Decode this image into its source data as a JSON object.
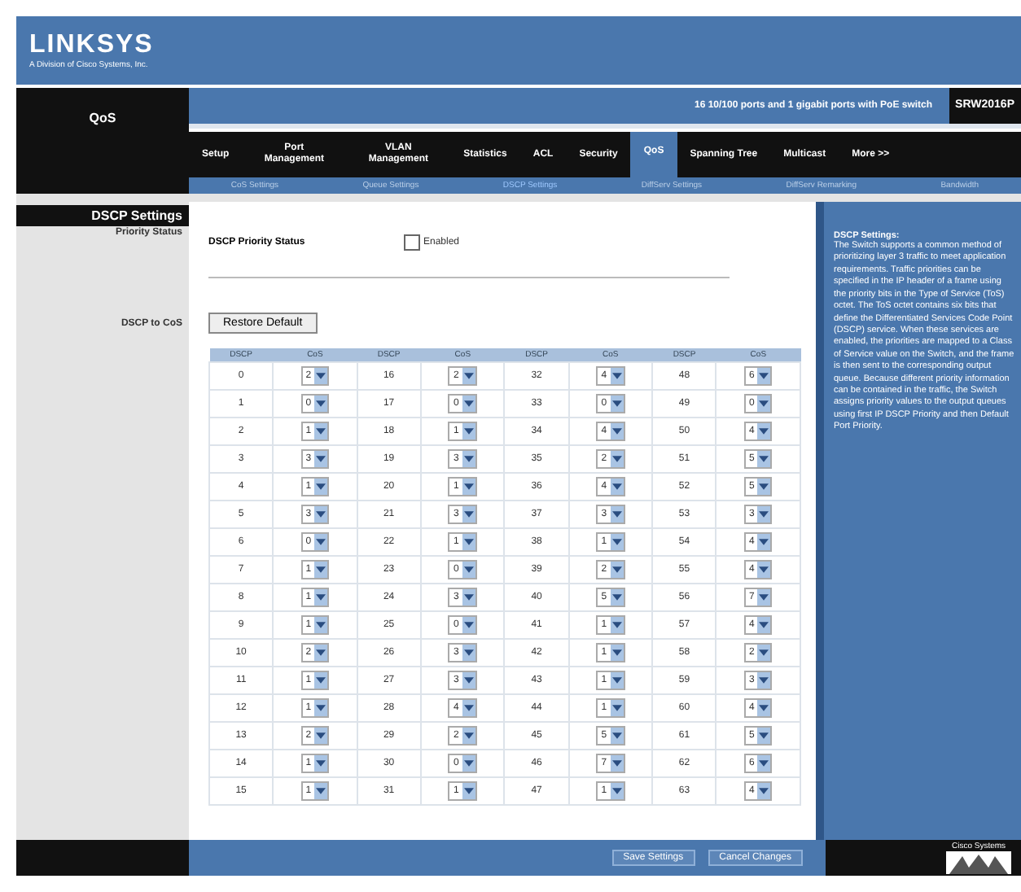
{
  "header": {
    "logo": "LINKSYS",
    "tagline": "A Division of Cisco Systems, Inc.",
    "section": "QoS",
    "description": "16 10/100 ports and 1 gigabit ports with PoE switch",
    "model": "SRW2016P"
  },
  "tabs": [
    {
      "label": "Setup",
      "selected": false
    },
    {
      "label": "Port Management",
      "selected": false
    },
    {
      "label": "VLAN Management",
      "selected": false
    },
    {
      "label": "Statistics",
      "selected": false
    },
    {
      "label": "ACL",
      "selected": false
    },
    {
      "label": "Security",
      "selected": false
    },
    {
      "label": "QoS",
      "selected": true
    },
    {
      "label": "Spanning Tree",
      "selected": false
    },
    {
      "label": "Multicast",
      "selected": false
    },
    {
      "label": "More >>",
      "selected": false
    }
  ],
  "subtabs": [
    {
      "label": "CoS Settings",
      "selected": false
    },
    {
      "label": "Queue Settings",
      "selected": false
    },
    {
      "label": "DSCP Settings",
      "selected": true
    },
    {
      "label": "DiffServ Settings",
      "selected": false
    },
    {
      "label": "DiffServ Remarking",
      "selected": false
    },
    {
      "label": "Bandwidth",
      "selected": false
    }
  ],
  "sidebar": {
    "title": "DSCP Settings",
    "items": [
      "Priority Status",
      "DSCP to CoS"
    ]
  },
  "priority_status": {
    "label": "DSCP Priority Status",
    "checkbox_label": "Enabled",
    "checked": false
  },
  "restore_button": "Restore Default",
  "table": {
    "columns": [
      "DSCP",
      "CoS",
      "DSCP",
      "CoS",
      "DSCP",
      "CoS",
      "DSCP",
      "CoS"
    ],
    "rows": [
      [
        "0",
        "2",
        "16",
        "2",
        "32",
        "4",
        "48",
        "6"
      ],
      [
        "1",
        "0",
        "17",
        "0",
        "33",
        "0",
        "49",
        "0"
      ],
      [
        "2",
        "1",
        "18",
        "1",
        "34",
        "4",
        "50",
        "4"
      ],
      [
        "3",
        "3",
        "19",
        "3",
        "35",
        "2",
        "51",
        "5"
      ],
      [
        "4",
        "1",
        "20",
        "1",
        "36",
        "4",
        "52",
        "5"
      ],
      [
        "5",
        "3",
        "21",
        "3",
        "37",
        "3",
        "53",
        "3"
      ],
      [
        "6",
        "0",
        "22",
        "1",
        "38",
        "1",
        "54",
        "4"
      ],
      [
        "7",
        "1",
        "23",
        "0",
        "39",
        "2",
        "55",
        "4"
      ],
      [
        "8",
        "1",
        "24",
        "3",
        "40",
        "5",
        "56",
        "7"
      ],
      [
        "9",
        "1",
        "25",
        "0",
        "41",
        "1",
        "57",
        "4"
      ],
      [
        "10",
        "2",
        "26",
        "3",
        "42",
        "1",
        "58",
        "2"
      ],
      [
        "11",
        "1",
        "27",
        "3",
        "43",
        "1",
        "59",
        "3"
      ],
      [
        "12",
        "1",
        "28",
        "4",
        "44",
        "1",
        "60",
        "4"
      ],
      [
        "13",
        "2",
        "29",
        "2",
        "45",
        "5",
        "61",
        "5"
      ],
      [
        "14",
        "1",
        "30",
        "0",
        "46",
        "7",
        "62",
        "6"
      ],
      [
        "15",
        "1",
        "31",
        "1",
        "47",
        "1",
        "63",
        "4"
      ]
    ]
  },
  "help": {
    "title": "DSCP Settings:",
    "text": "The Switch supports a common method of prioritizing layer 3 traffic to meet application requirements. Traffic priorities can be specified in the IP header of a frame using the priority bits in the Type of Service (ToS) octet. The ToS octet contains six bits that define the Differentiated Services Code Point (DSCP) service. When these services are enabled, the priorities are mapped to a Class of Service value on the Switch, and the frame is then sent to the corresponding output queue. Because different priority information can be contained in the traffic, the Switch assigns priority values to the output queues using first IP DSCP Priority and then Default Port Priority."
  },
  "buttons": [
    "Save Settings",
    "Cancel Changes"
  ],
  "footer_logo": "Cisco Systems"
}
